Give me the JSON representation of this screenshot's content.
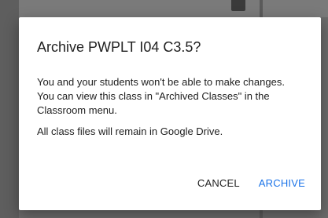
{
  "dialog": {
    "title": "Archive PWPLT I04 C3.5?",
    "body_paragraph_1": "You and your students won't be able to make changes. You can view this class in \"Archived Classes\" in the Classroom menu.",
    "body_paragraph_2": "All class files will remain in Google Drive.",
    "cancel_label": "CANCEL",
    "archive_label": "ARCHIVE"
  },
  "colors": {
    "accent": "#1a73e8",
    "text": "#212121",
    "scrim": "#6b6b6b"
  }
}
